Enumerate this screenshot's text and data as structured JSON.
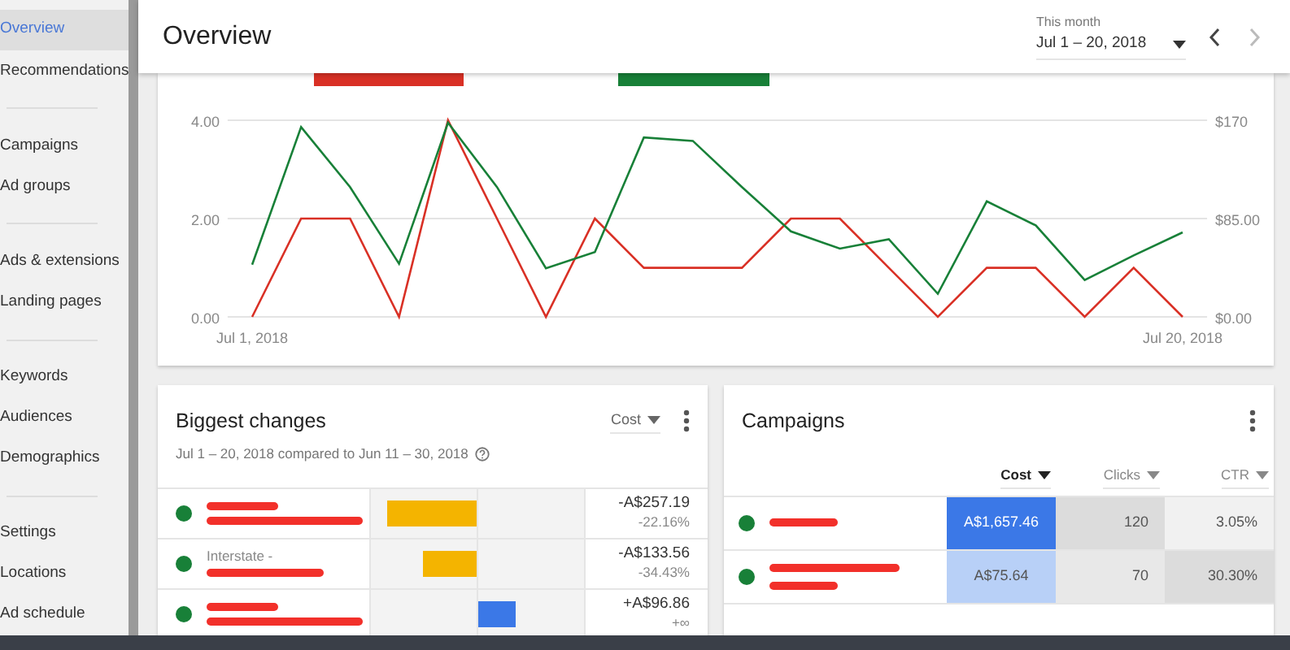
{
  "sidebar": {
    "items": [
      {
        "label": "Overview",
        "selected": true
      },
      {
        "label": "Recommendations",
        "selected": false
      },
      {
        "kind": "divider"
      },
      {
        "label": "Campaigns",
        "selected": false
      },
      {
        "label": "Ad groups",
        "selected": false
      },
      {
        "kind": "divider"
      },
      {
        "label": "Ads & extensions",
        "selected": false
      },
      {
        "label": "Landing pages",
        "selected": false
      },
      {
        "kind": "divider"
      },
      {
        "label": "Keywords",
        "selected": false
      },
      {
        "label": "Audiences",
        "selected": false
      },
      {
        "label": "Demographics",
        "selected": false
      },
      {
        "kind": "divider"
      },
      {
        "label": "Settings",
        "selected": false
      },
      {
        "label": "Locations",
        "selected": false
      },
      {
        "label": "Ad schedule",
        "selected": false
      }
    ]
  },
  "header": {
    "title": "Overview",
    "date_range": {
      "label": "This month",
      "value": "Jul 1 – 20, 2018"
    }
  },
  "overview_chart": {
    "right_axis_labels": [
      "$170",
      "$85.00",
      "$0.00"
    ],
    "chart_data": {
      "type": "line",
      "categories": [
        "Jul 1, 2018",
        null,
        null,
        null,
        null,
        null,
        null,
        null,
        null,
        null,
        null,
        null,
        null,
        null,
        null,
        null,
        null,
        null,
        null,
        "Jul 20, 2018"
      ],
      "ylim": [
        0,
        4
      ],
      "yticks": [
        {
          "value": 0,
          "label": "0.00"
        },
        {
          "value": 2,
          "label": "2.00"
        },
        {
          "value": 4,
          "label": "4.00"
        }
      ],
      "series": [
        {
          "color": "#d93025",
          "values": [
            0,
            2,
            2,
            0,
            4,
            2,
            0,
            2,
            1,
            1,
            1,
            2,
            2,
            1,
            0,
            1,
            1,
            0,
            1,
            0
          ]
        },
        {
          "color": "#188038",
          "values": [
            1.06,
            3.86,
            2.64,
            1.08,
            3.95,
            2.64,
            0.99,
            1.32,
            3.65,
            3.58,
            2.64,
            1.74,
            1.39,
            1.58,
            0.47,
            2.35,
            1.86,
            0.75,
            1.25,
            1.72
          ]
        }
      ]
    }
  },
  "biggest_changes": {
    "title": "Biggest changes",
    "subtitle": "Jul 1 – 20, 2018 compared to Jun 11 – 30, 2018",
    "metric": "Cost",
    "rows": [
      {
        "kind": "decrease",
        "level": 0.83,
        "value": "-A$257.19",
        "percent": "-22.16%"
      },
      {
        "kind": "decrease",
        "name": "Interstate -",
        "level": 0.5,
        "value": "-A$133.56",
        "percent": "-34.43%"
      },
      {
        "kind": "increase",
        "level": 0.36,
        "value": "+A$96.86",
        "percent": "+∞"
      }
    ]
  },
  "campaigns": {
    "title": "Campaigns",
    "columns": [
      {
        "label": "Cost",
        "selected": true
      },
      {
        "label": "Clicks",
        "selected": false
      },
      {
        "label": "CTR",
        "selected": false
      }
    ],
    "rows": [
      {
        "cells": [
          {
            "text": "A$1,657.46",
            "color": "#3b78e7"
          },
          {
            "text": "120",
            "color": "#dcdcdc"
          },
          {
            "text": "3.05%",
            "color": "#f1f1f1"
          }
        ]
      },
      {
        "cells": [
          {
            "text": "A$75.64",
            "color": "#b8d0f7"
          },
          {
            "text": "70",
            "color": "#e8e8e8"
          },
          {
            "text": "30.30%",
            "color": "#dcdcdc"
          }
        ]
      }
    ]
  }
}
